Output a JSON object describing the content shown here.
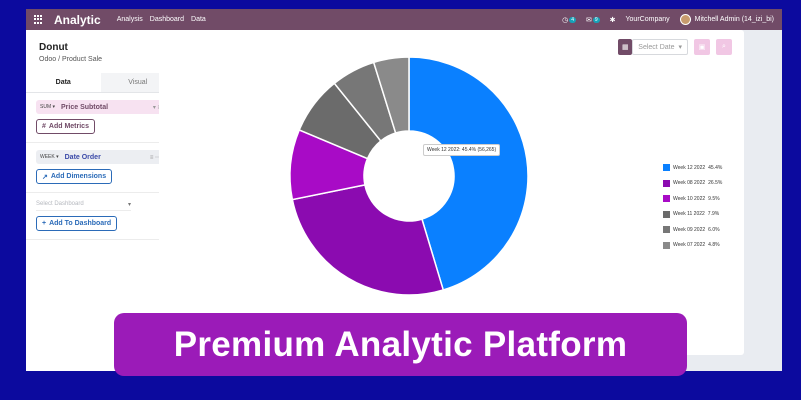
{
  "navbar": {
    "brand": "Analytic",
    "menus": [
      "Analysis",
      "Dashboard",
      "Data"
    ],
    "activity_count": "4",
    "messages_count": "9",
    "company": "YourCompany",
    "user": "Mitchell Admin (14_izi_bi)"
  },
  "panel": {
    "title": "Donut",
    "subtitle": "Odoo / Product Sale",
    "tabs": [
      "Data",
      "Visual"
    ],
    "metric": {
      "tag": "SUM ▾",
      "label": "Price Subtotal"
    },
    "add_metrics": "Add Metrics",
    "dimension": {
      "tag": "WEEK ▾",
      "label": "Date Order"
    },
    "add_dimensions": "Add Dimensions",
    "select_dashboard_placeholder": "Select Dashboard",
    "add_to_dashboard": "Add To Dashboard"
  },
  "toolbar": {
    "select_date": "Select Date"
  },
  "tooltip": "Week 12 2022: 45.4% (56,265)",
  "chart_data": {
    "type": "pie",
    "variant": "donut",
    "categories": [
      "Week 12 2022",
      "Week 08 2022",
      "Week 10 2022",
      "Week 11 2022",
      "Week 09 2022",
      "Week 07 2022"
    ],
    "values": [
      45.4,
      26.5,
      9.5,
      7.9,
      6.0,
      4.8
    ],
    "value_labels": [
      "45.4%",
      "26.5%",
      "9.5%",
      "7.9%",
      "6.0%",
      "4.8%"
    ],
    "colors": [
      "#0a80ff",
      "#8b0bb0",
      "#a80bc6",
      "#6b6b6b",
      "#777777",
      "#8a8a8a"
    ],
    "legend_position": "right"
  },
  "banner": {
    "text": "Premium Analytic Platform"
  }
}
